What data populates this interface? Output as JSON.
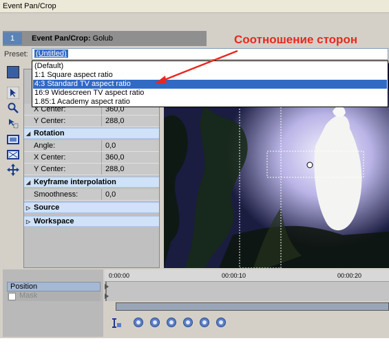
{
  "window": {
    "title": "Event Pan/Crop"
  },
  "header": {
    "track_number": "1",
    "event_title": "Event Pan/Crop:",
    "event_name": "Golub"
  },
  "preset": {
    "label": "Preset:",
    "value": "(Untitled)"
  },
  "annotation": {
    "text": "Соотношение сторон",
    "color": "#e8281e"
  },
  "dropdown": {
    "items": [
      {
        "label": "(Default)",
        "selected": false
      },
      {
        "label": "1:1 Square aspect ratio",
        "selected": false
      },
      {
        "label": "4:3 Standard TV aspect ratio",
        "selected": true
      },
      {
        "label": "16:9 Widescreen TV aspect ratio",
        "selected": false
      },
      {
        "label": "1.85:1 Academy aspect ratio",
        "selected": false
      }
    ]
  },
  "properties": {
    "position_rows": [
      {
        "label": "X Center:",
        "value": "360,0"
      },
      {
        "label": "Y Center:",
        "value": "288,0"
      }
    ],
    "rotation": {
      "title": "Rotation",
      "rows": [
        {
          "label": "Angle:",
          "value": "0,0"
        },
        {
          "label": "X Center:",
          "value": "360,0"
        },
        {
          "label": "Y Center:",
          "value": "288,0"
        }
      ]
    },
    "keyframe": {
      "title": "Keyframe interpolation",
      "rows": [
        {
          "label": "Smoothness:",
          "value": "0,0"
        }
      ]
    },
    "source": {
      "title": "Source"
    },
    "workspace": {
      "title": "Workspace"
    }
  },
  "timeline": {
    "tracks": {
      "position": "Position",
      "mask": "Mask"
    },
    "ruler": [
      "0:00:00",
      "00:00:10",
      "00:00:20"
    ]
  },
  "colors": {
    "selection": "#316ac5",
    "section_bg": "#cfe2f7"
  }
}
